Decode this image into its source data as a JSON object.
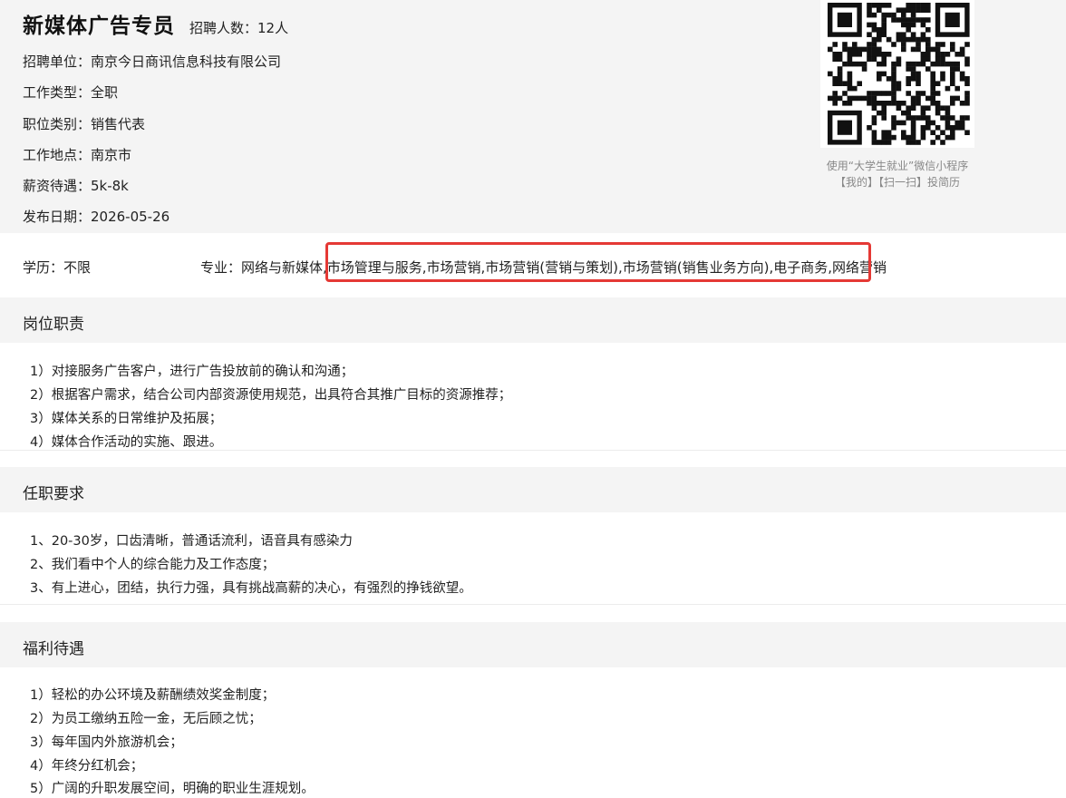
{
  "job": {
    "title": "新媒体广告专员",
    "headcount": "招聘人数：12人",
    "employer": "招聘单位：南京今日商讯信息科技有限公司",
    "work_type": "工作类型：全职",
    "category": "职位类别：销售代表",
    "location": "工作地点：南京市",
    "salary": "薪资待遇：5k-8k",
    "post_date": "发布日期：2026-05-26"
  },
  "qr": {
    "caption_line1": "使用“大学生就业”微信小程序",
    "caption_line2": "【我的】【扫一扫】投简历"
  },
  "requirements_row": {
    "education": "学历：不限",
    "major": "专业：网络与新媒体,市场管理与服务,市场营销,市场营销(营销与策划),市场营销(销售业务方向),电子商务,网络营销",
    "highlight_color": "#e53935"
  },
  "sections": {
    "duties": {
      "title": "岗位职责",
      "items": [
        "1）对接服务广告客户，进行广告投放前的确认和沟通；",
        "2）根据客户需求，结合公司内部资源使用规范，出具符合其推广目标的资源推荐；",
        "3）媒体关系的日常维护及拓展；",
        "4）媒体合作活动的实施、跟进。"
      ]
    },
    "qualifications": {
      "title": "任职要求",
      "items": [
        "1、20-30岁，口齿清晰，普通话流利，语音具有感染力",
        "2、我们看中个人的综合能力及工作态度；",
        "3、有上进心，团结，执行力强，具有挑战高薪的决心，有强烈的挣钱欲望。"
      ]
    },
    "benefits": {
      "title": "福利待遇",
      "items": [
        "1）轻松的办公环境及薪酬绩效奖金制度；",
        "2）为员工缴纳五险一金，无后顾之忧；",
        "3）每年国内外旅游机会；",
        "4）年终分红机会；",
        "5）广阔的升职发展空间，明确的职业生涯规划。"
      ]
    }
  }
}
